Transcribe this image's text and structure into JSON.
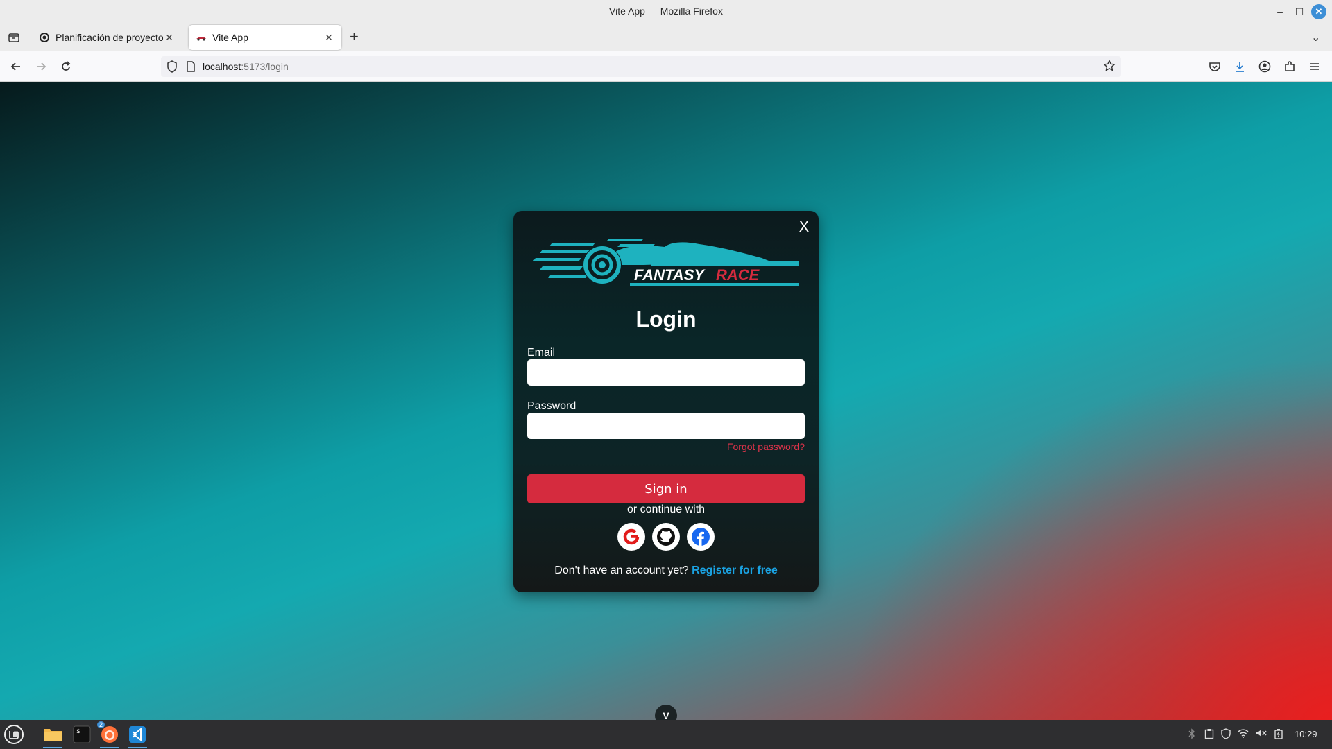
{
  "window": {
    "title": "Vite App — Mozilla Firefox"
  },
  "tabs": [
    {
      "label": "Planificación de proyecto y l",
      "active": false
    },
    {
      "label": "Vite App",
      "active": true
    }
  ],
  "navbar": {
    "url_host": "localhost",
    "url_path": ":5173/login"
  },
  "login": {
    "close_label": "X",
    "logo_text_1": "FANTASY",
    "logo_text_2": "RACE",
    "title": "Login",
    "email_label": "Email",
    "email_value": "",
    "password_label": "Password",
    "password_value": "",
    "forgot_label": "Forgot password?",
    "signin_label": "Sign in",
    "continue_label": "or continue with",
    "no_account_label": "Don't have an account yet?",
    "register_label": "Register for free",
    "social_icons": [
      "google-icon",
      "github-icon",
      "facebook-icon"
    ]
  },
  "scroll_down_label": "V",
  "taskbar": {
    "firefox_badge": "2",
    "clock": "10:29"
  },
  "colors": {
    "accent_red": "#d52b3e",
    "link_blue": "#1aa3e3",
    "logo_teal": "#1eb2bf"
  }
}
